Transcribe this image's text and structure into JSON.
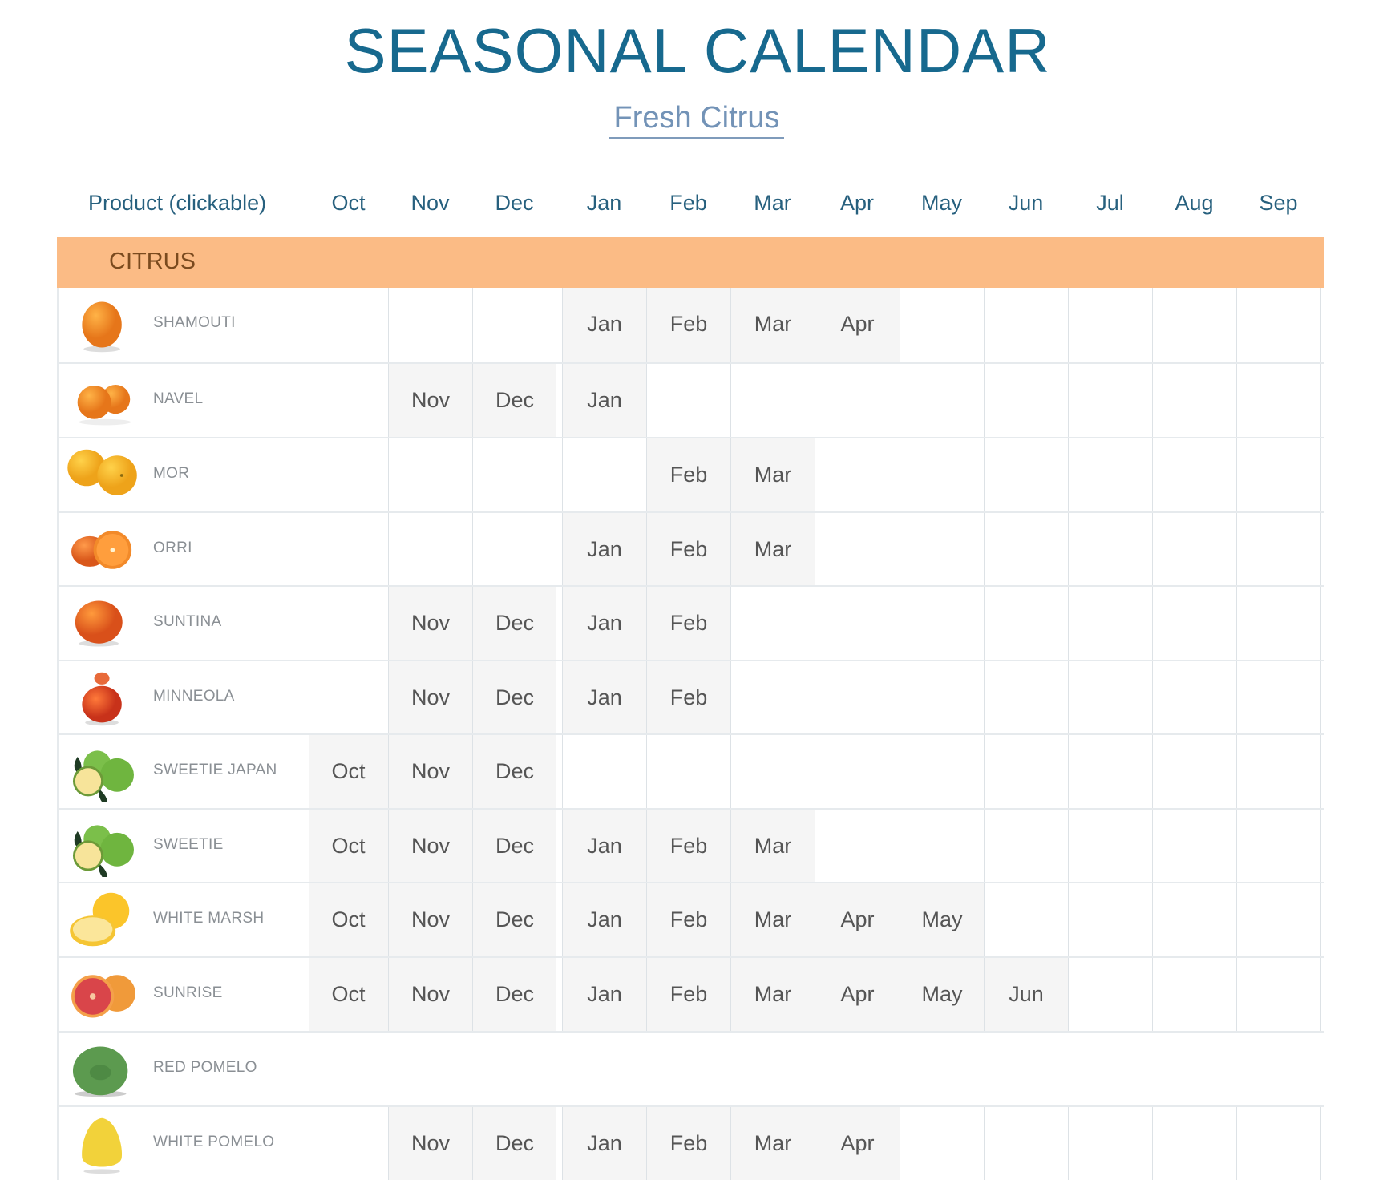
{
  "header": {
    "title": "SEASONAL CALENDAR",
    "subtitle": "Fresh Citrus",
    "product_column": "Product (clickable)",
    "months": [
      "Oct",
      "Nov",
      "Dec",
      "Jan",
      "Feb",
      "Mar",
      "Apr",
      "May",
      "Jun",
      "Jul",
      "Aug",
      "Sep"
    ]
  },
  "category": {
    "label": "CITRUS",
    "color": "#fbbb85"
  },
  "colors": {
    "title": "#17698e",
    "subtitle": "#7393b7",
    "in_season_fill": "#f5f5f5"
  },
  "products": [
    {
      "name": "SHAMOUTI",
      "icon": "orange-icon",
      "season": [
        "Jan",
        "Feb",
        "Mar",
        "Apr"
      ]
    },
    {
      "name": "NAVEL",
      "icon": "navel-orange-icon",
      "season": [
        "Nov",
        "Dec",
        "Jan"
      ]
    },
    {
      "name": "MOR",
      "icon": "mandarin-icon",
      "season": [
        "Feb",
        "Mar"
      ]
    },
    {
      "name": "ORRI",
      "icon": "orri-mandarin-icon",
      "season": [
        "Jan",
        "Feb",
        "Mar"
      ]
    },
    {
      "name": "SUNTINA",
      "icon": "suntina-icon",
      "season": [
        "Nov",
        "Dec",
        "Jan",
        "Feb"
      ]
    },
    {
      "name": "MINNEOLA",
      "icon": "minneola-icon",
      "season": [
        "Nov",
        "Dec",
        "Jan",
        "Feb"
      ]
    },
    {
      "name": "SWEETIE JAPAN",
      "icon": "sweetie-icon",
      "season": [
        "Oct",
        "Nov",
        "Dec"
      ]
    },
    {
      "name": "SWEETIE",
      "icon": "sweetie-icon",
      "season": [
        "Oct",
        "Nov",
        "Dec",
        "Jan",
        "Feb",
        "Mar"
      ]
    },
    {
      "name": "WHITE MARSH",
      "icon": "grapefruit-icon",
      "season": [
        "Oct",
        "Nov",
        "Dec",
        "Jan",
        "Feb",
        "Mar",
        "Apr",
        "May"
      ]
    },
    {
      "name": "SUNRISE",
      "icon": "red-grapefruit-icon",
      "season": [
        "Oct",
        "Nov",
        "Dec",
        "Jan",
        "Feb",
        "Mar",
        "Apr",
        "May",
        "Jun"
      ]
    },
    {
      "name": "RED POMELO",
      "icon": "green-pomelo-icon",
      "season": [],
      "no_grid": true
    },
    {
      "name": "WHITE POMELO",
      "icon": "yellow-pomelo-icon",
      "season": [
        "Nov",
        "Dec",
        "Jan",
        "Feb",
        "Mar",
        "Apr"
      ]
    }
  ]
}
